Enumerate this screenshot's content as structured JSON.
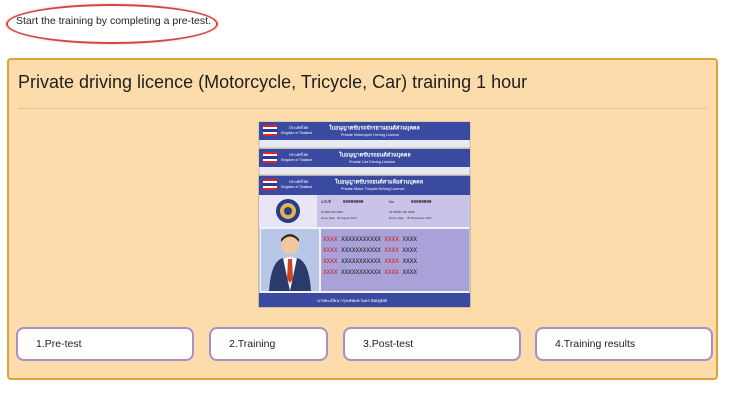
{
  "instruction": {
    "text": "Start the training by completing a pre-test."
  },
  "course": {
    "title": "Private driving licence (Motorcycle, Tricycle, Car) training 1 hour"
  },
  "licence_image": {
    "cards": [
      {
        "th_title": "ใบอนุญาตขับรถจักรยานยนต์ส่วนบุคคล",
        "en_title": "Private Motorcycle Driving Licence"
      },
      {
        "th_title": "ใบอนุญาตขับรถยนต์ส่วนบุคคล",
        "en_title": "Private Car Driving Licence"
      },
      {
        "th_title": "ใบอนุญาตขับรถยนต์สามล้อส่วนบุคคล",
        "en_title": "Private Motor Tricycle Driving Licence"
      }
    ],
    "country_th": "ประเทศไทย",
    "country_en": "Kingdom of Thailand",
    "number_label_th": "ฉบับที่",
    "number_value": "60999999",
    "no_label": "No.",
    "no_value": "60999999",
    "issue_label": "Issue Date",
    "issue_th": "30 สิงหาคม 2560",
    "issue_en": "30 August 2017",
    "expiry_label": "Expiry Date",
    "expiry_th": "30 พฤศจิกายน 2565",
    "expiry_en": "30 November 2022",
    "masked_rows": [
      {
        "a": "XXXX",
        "b": "XXXXXXXXXXX",
        "c": "XXXX",
        "d": "XXXX"
      },
      {
        "a": "XXXX",
        "b": "XXXXXXXXXXX",
        "c": "XXXX",
        "d": "XXXX"
      },
      {
        "a": "XXXX",
        "b": "XXXXXXXXXXX",
        "c": "XXXX",
        "d": "XXXX"
      },
      {
        "a": "XXXX",
        "b": "XXXXXXXXXXX",
        "c": "XXXX",
        "d": "XXXX"
      }
    ],
    "footer": "นายทะเบียน กรุงเทพมหานคร Bangkok"
  },
  "steps": [
    {
      "label": "1.Pre-test"
    },
    {
      "label": "2.Training"
    },
    {
      "label": "3.Post-test"
    },
    {
      "label": "4.Training results"
    }
  ],
  "colors": {
    "card_bg": "#fcdcaa",
    "card_border": "#e0a23a",
    "button_border": "#a98fc2",
    "highlight_ellipse": "#d64545",
    "licence_header_blue": "#3a4aa0",
    "licence_body_purple": "#a9a2d8"
  }
}
